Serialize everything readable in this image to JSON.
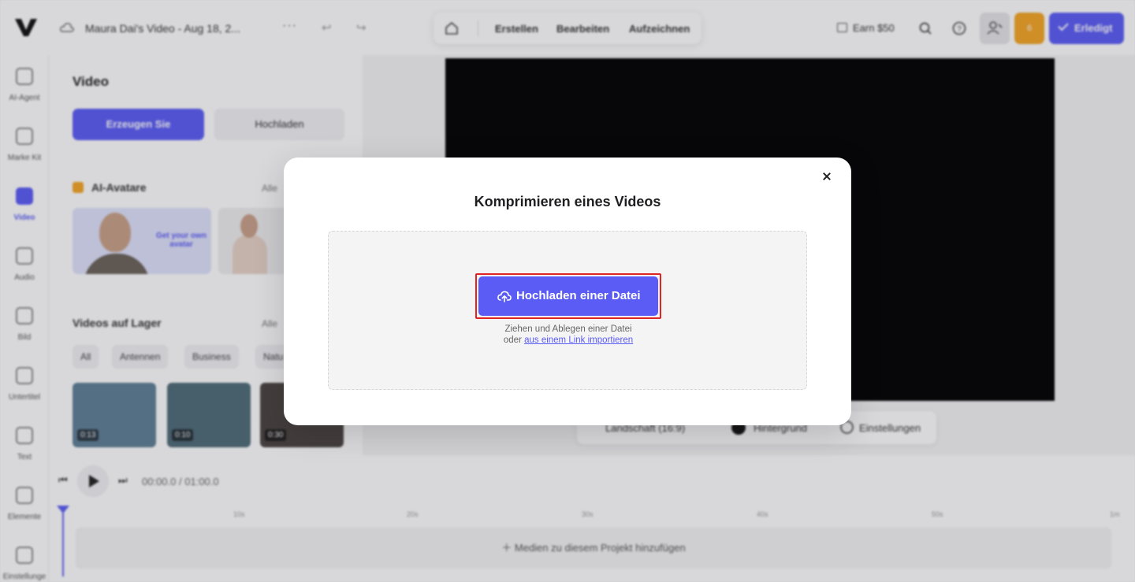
{
  "topbar": {
    "project_title": "Maura Dai's Video - Aug 18, 2...",
    "more_icon": "more-horizontal-icon",
    "modes": [
      "Erstellen",
      "Bearbeiten",
      "Aufzeichnen"
    ],
    "earn_label": "Earn $50",
    "credit_label": "6",
    "done_label": "Erledigt"
  },
  "rail": {
    "items": [
      {
        "label": "AI-Agent",
        "icon": "ai-agent-icon"
      },
      {
        "label": "Marke Kit",
        "icon": "brand-kit-icon"
      },
      {
        "label": "Video",
        "icon": "video-icon",
        "active": true
      },
      {
        "label": "Audio",
        "icon": "audio-icon"
      },
      {
        "label": "Bild",
        "icon": "image-icon"
      },
      {
        "label": "Untertitel",
        "icon": "subtitles-icon"
      },
      {
        "label": "Text",
        "icon": "text-icon"
      },
      {
        "label": "Elemente",
        "icon": "elements-icon"
      },
      {
        "label": "Einstellunge",
        "icon": "settings-icon"
      }
    ]
  },
  "panel": {
    "title": "Video",
    "generate_label": "Erzeugen Sie",
    "upload_label": "Hochladen",
    "avatars_title": "AI-Avatare",
    "avatars_more": "Alle",
    "avatar_cta": "Get your own avatar",
    "stock_title": "Videos auf Lager",
    "stock_more": "Alle",
    "chips": [
      "All",
      "Antennen",
      "Business",
      "Natu"
    ],
    "thumbs": [
      {
        "duration": "0:13",
        "color": "#5f7f96"
      },
      {
        "duration": "0:10",
        "color": "#4f6b78"
      },
      {
        "duration": "0:30",
        "color": "#4a4340"
      }
    ]
  },
  "canvas_toolbar": {
    "aspect_label": "Landschaft (16:9)",
    "background_label": "Hintergrund",
    "settings_label": "Einstellungen"
  },
  "timeline": {
    "current_time": "00:00.0",
    "separator": "/",
    "total_time": "01:00.0",
    "ticks": [
      "10s",
      "20s",
      "30s",
      "40s",
      "50s",
      "1m"
    ],
    "add_media_label": "Medien zu diesem Projekt hinzufügen"
  },
  "modal": {
    "title": "Komprimieren eines Videos",
    "upload_button_label": "Hochladen einer Datei",
    "drop_hint_line1": "Ziehen und Ablegen einer Datei",
    "drop_hint_or": "oder",
    "drop_link_label": "aus einem Link importieren"
  },
  "colors": {
    "accent": "#5b5cf6",
    "highlight": "#e02424",
    "credit": "#f5a524"
  }
}
